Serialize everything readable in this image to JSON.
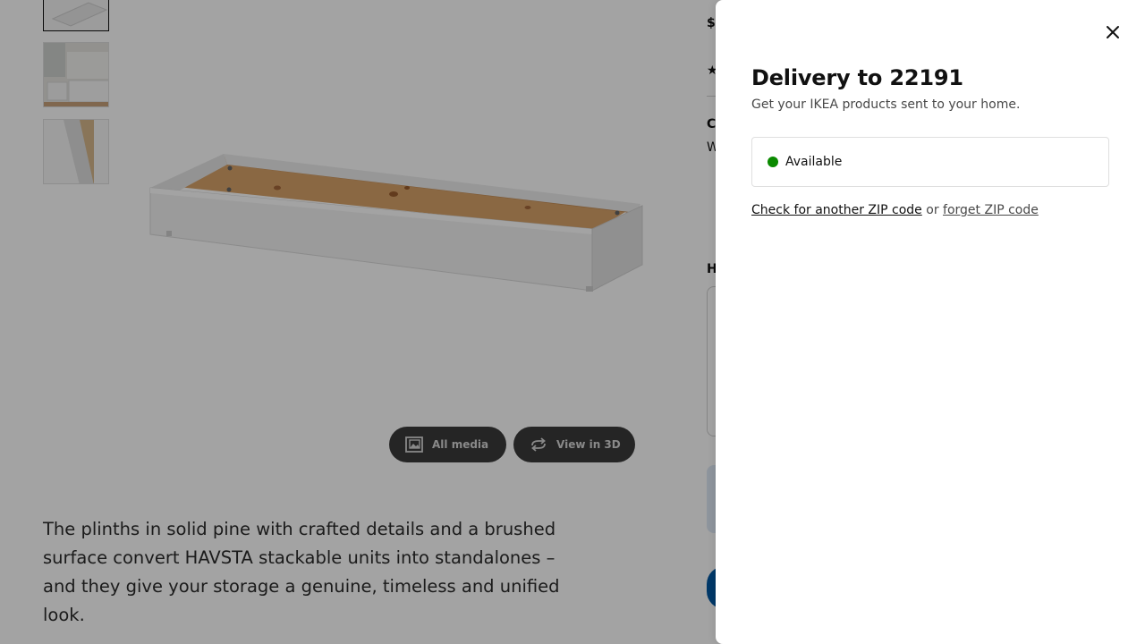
{
  "product_page": {
    "thumbnails": [
      {
        "alt": "thumbnail-1"
      },
      {
        "alt": "thumbnail-2"
      },
      {
        "alt": "thumbnail-3"
      }
    ],
    "buttons": {
      "all_media": "All media",
      "view_3d": "View in 3D"
    },
    "description": "The plinths in solid pine with crafted details and a brushed surface convert HAVSTA stackable units into standalones – and they give your storage a genuine, timeless and unified look.",
    "info_fragments": {
      "price": "$",
      "color_label": "C",
      "color_value": "W",
      "height_label": "H"
    }
  },
  "delivery_modal": {
    "title": "Delivery to 22191",
    "subtitle": "Get your IKEA products sent to your home.",
    "status": "Available",
    "status_color": "#0a8a00",
    "check_link": "Check for another ZIP code",
    "separator": "or",
    "forget_link": "forget ZIP code"
  },
  "colors": {
    "overlay": "rgba(0,0,0,0.36)",
    "button_dark": "#3a3a3a",
    "ikea_blue": "#0058a3"
  }
}
